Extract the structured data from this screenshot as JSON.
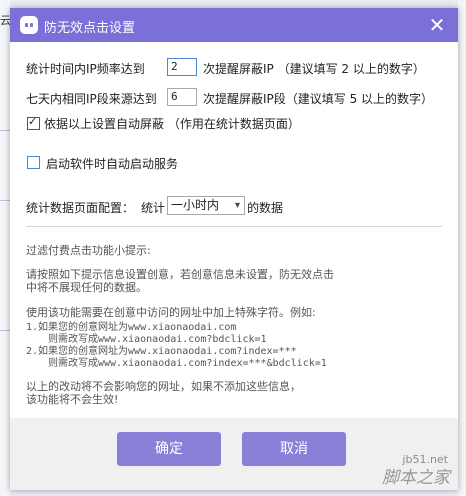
{
  "background": {
    "left_text": "云"
  },
  "dialog": {
    "title": "防无效点击设置",
    "close_icon": "close-icon"
  },
  "settings": {
    "row1": {
      "label": "统计时间内IP频率达到",
      "value": "2",
      "suffix": "次提醒屏蔽IP  （建议填写 2 以上的数字）"
    },
    "row2": {
      "label": "七天内相同IP段来源达到",
      "value": "6",
      "suffix": "次提醒屏蔽IP段（建议填写 5 以上的数字）"
    },
    "auto_block": {
      "label": "依据以上设置自动屏蔽 （作用在统计数据页面）",
      "checked": true
    },
    "auto_start": {
      "label": "启动软件时自动启动服务",
      "checked": false
    },
    "stats_config": {
      "label": "统计数据页面配置：",
      "prefix": "统计",
      "selected": "一小时内",
      "suffix": "的数据"
    }
  },
  "tips": {
    "heading": "过滤付费点击功能小提示:",
    "p1_line1": "请按照如下提示信息设置创意，若创意信息未设置，防无效点击",
    "p1_line2": "中将不展现任何的数据。",
    "p2_line1": "使用该功能需要在创意中访问的网址中加上特殊字符。例如:",
    "ex1_line1": "1.如果您的创意网址为www.xiaonaodai.com",
    "ex1_line2": "则需改写成www.xiaonaodai.com?bdclick=1",
    "ex2_line1": "2.如果您的创意网址为www.xiaonaodai.com?index=***",
    "ex2_line2": "则需改写成www.xiaonaodai.com?index=***&bdclick=1",
    "p3_line1": "以上的改动将不会影响您的网址，如果不添加这些信息，",
    "p3_line2": "该功能将不会生效!"
  },
  "buttons": {
    "ok": "确定",
    "cancel": "取消"
  },
  "watermark": {
    "site": "jb51.net",
    "name": "脚本之家"
  },
  "colors": {
    "title_bar": "#7b6fd8",
    "button": "#8a80d8"
  }
}
